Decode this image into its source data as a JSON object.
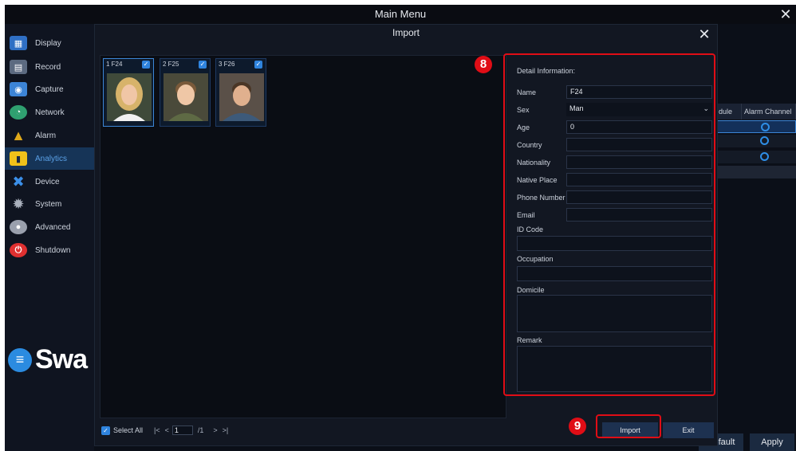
{
  "window": {
    "title": "Main Menu"
  },
  "sidebar": {
    "items": [
      {
        "label": "Display",
        "icon": "display-icon",
        "color": "#2f6fc4"
      },
      {
        "label": "Record",
        "icon": "record-icon",
        "color": "#5c6a80"
      },
      {
        "label": "Capture",
        "icon": "capture-icon",
        "color": "#3c84d6"
      },
      {
        "label": "Network",
        "icon": "network-icon",
        "color": "#2fa070"
      },
      {
        "label": "Alarm",
        "icon": "alarm-icon",
        "color": "#e0a91a"
      },
      {
        "label": "Analytics",
        "icon": "analytics-icon",
        "color": "#f0c21a"
      },
      {
        "label": "Device",
        "icon": "device-icon",
        "color": "#3b8fe8"
      },
      {
        "label": "System",
        "icon": "system-icon",
        "color": "#7f8797"
      },
      {
        "label": "Advanced",
        "icon": "advanced-icon",
        "color": "#9aa0ad"
      },
      {
        "label": "Shutdown",
        "icon": "shutdown-icon",
        "color": "#e03030"
      }
    ],
    "active_index": 5,
    "brand_text": "Swa"
  },
  "background_panel": {
    "headers": [
      "dule",
      "Alarm Channel"
    ],
    "buttons": {
      "default": "Default",
      "apply": "Apply"
    }
  },
  "dialog": {
    "title": "Import",
    "thumbnails": [
      {
        "label": "1 F24",
        "checked": true,
        "selected": true
      },
      {
        "label": "2 F25",
        "checked": true,
        "selected": false
      },
      {
        "label": "3 F26",
        "checked": true,
        "selected": false
      }
    ],
    "pager": {
      "select_all": "Select All",
      "first": "|<",
      "prev": "<",
      "current_page": "1",
      "total": "/1",
      "next": ">",
      "last": ">|"
    },
    "detail": {
      "title": "Detail Information:",
      "name_label": "Name",
      "name_value": "F24",
      "sex_label": "Sex",
      "sex_value": "Man",
      "age_label": "Age",
      "age_value": "0",
      "country_label": "Country",
      "country_value": "",
      "nationality_label": "Nationality",
      "nationality_value": "",
      "native_place_label": "Native Place",
      "native_place_value": "",
      "phone_label": "Phone Number",
      "phone_value": "",
      "email_label": "Email",
      "email_value": "",
      "id_code_label": "ID Code",
      "occupation_label": "Occupation",
      "domicile_label": "Domicile",
      "remark_label": "Remark"
    },
    "buttons": {
      "import": "Import",
      "exit": "Exit"
    }
  },
  "callouts": {
    "detail_badge": "8",
    "import_badge": "9",
    "color": "#e00d16"
  }
}
